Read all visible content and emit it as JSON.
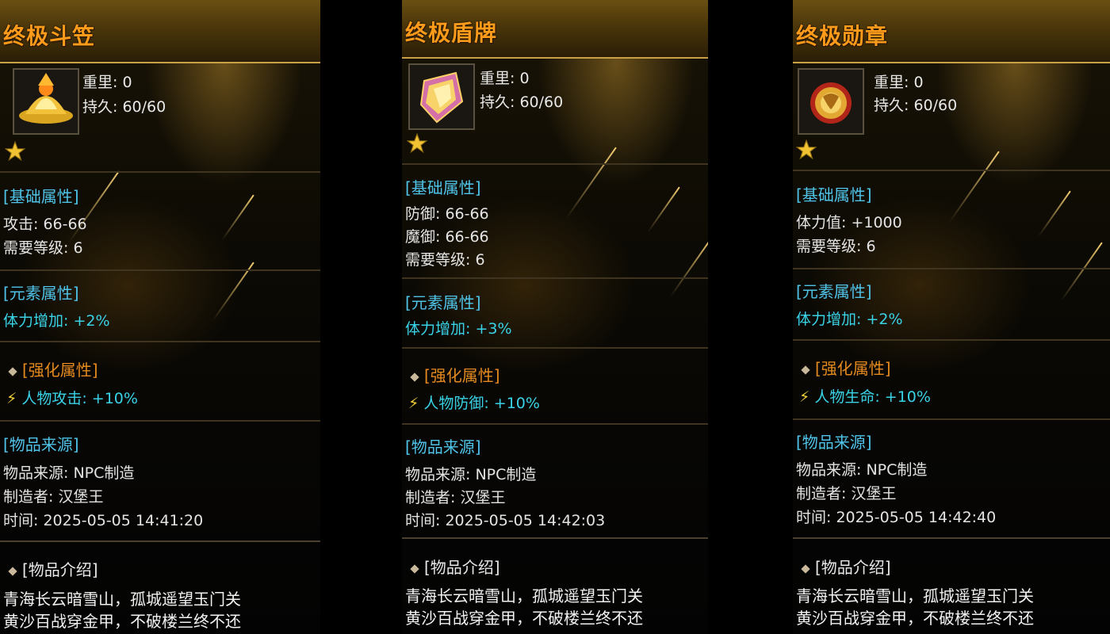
{
  "items": [
    {
      "name": "终极斗笠",
      "weight": "重里: 0",
      "durability": "持久: 60/60",
      "base_header": "[基础属性]",
      "base_lines": [
        "攻击: 66-66",
        "需要等级: 6"
      ],
      "element_header": "[元素属性]",
      "element_line": "体力增加: +2%",
      "enhance_header": "[强化属性]",
      "enhance_line": "人物攻击: +10%",
      "source_header": "[物品来源]",
      "source": "物品来源: NPC制造",
      "maker": "制造者: 汉堡王",
      "time": "时间: 2025-05-05 14:41:20",
      "intro_header": "[物品介绍]",
      "poem": [
        "青海长云暗雪山，孤城遥望玉门关",
        "黄沙百战穿金甲，不破楼兰终不还"
      ],
      "icon": "golden-hat-icon"
    },
    {
      "name": "终极盾牌",
      "weight": "重里: 0",
      "durability": "持久: 60/60",
      "base_header": "[基础属性]",
      "base_lines": [
        "防御: 66-66",
        "魔御: 66-66",
        "需要等级: 6"
      ],
      "element_header": "[元素属性]",
      "element_line": "体力增加: +3%",
      "enhance_header": "[强化属性]",
      "enhance_line": "人物防御: +10%",
      "source_header": "[物品来源]",
      "source": "物品来源: NPC制造",
      "maker": "制造者: 汉堡王",
      "time": "时间: 2025-05-05 14:42:03",
      "intro_header": "[物品介绍]",
      "poem": [
        "青海长云暗雪山，孤城遥望玉门关",
        "黄沙百战穿金甲，不破楼兰终不还"
      ],
      "icon": "shield-icon"
    },
    {
      "name": "终极勋章",
      "weight": "重里: 0",
      "durability": "持久: 60/60",
      "base_header": "[基础属性]",
      "base_lines": [
        "体力值: +1000",
        "需要等级: 6"
      ],
      "element_header": "[元素属性]",
      "element_line": "体力增加: +2%",
      "enhance_header": "[强化属性]",
      "enhance_line": "人物生命: +10%",
      "source_header": "[物品来源]",
      "source": "物品来源: NPC制造",
      "maker": "制造者: 汉堡王",
      "time": "时间: 2025-05-05 14:42:40",
      "intro_header": "[物品介绍]",
      "poem": [
        "青海长云暗雪山，孤城遥望玉门关",
        "黄沙百战穿金甲，不破楼兰终不还"
      ],
      "icon": "medal-icon"
    }
  ],
  "colors": {
    "title": "#ff9b1a",
    "section": "#4fc3e8",
    "element": "#39d2e6",
    "enhance_header": "#e58a1f",
    "text": "#e4e4e4"
  }
}
